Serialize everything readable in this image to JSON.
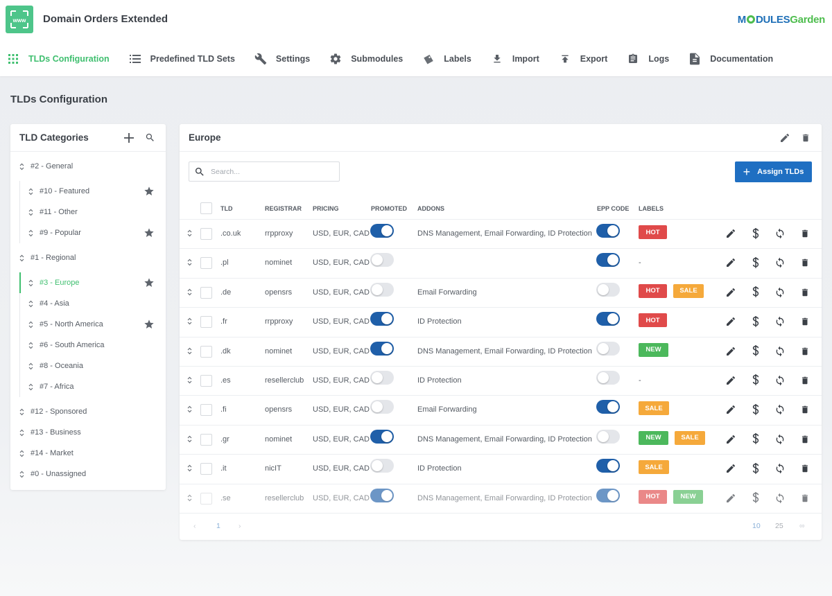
{
  "app": {
    "title": "Domain Orders Extended",
    "brand_part1": "M",
    "brand_part2": "DULES",
    "brand_part3": "Garden"
  },
  "nav": [
    {
      "label": "TLDs Configuration",
      "icon": "grid-icon",
      "active": true
    },
    {
      "label": "Predefined TLD Sets",
      "icon": "list-icon"
    },
    {
      "label": "Settings",
      "icon": "wrench-icon"
    },
    {
      "label": "Submodules",
      "icon": "gear-icon"
    },
    {
      "label": "Labels",
      "icon": "label-icon"
    },
    {
      "label": "Import",
      "icon": "download-icon"
    },
    {
      "label": "Export",
      "icon": "upload-icon"
    },
    {
      "label": "Logs",
      "icon": "clipboard-icon"
    },
    {
      "label": "Documentation",
      "icon": "document-icon"
    }
  ],
  "page_title": "TLDs Configuration",
  "categories_panel": {
    "title": "TLD Categories",
    "groups": [
      {
        "label": "#2 - General",
        "children": [
          {
            "label": "#10 - Featured",
            "starred": true
          },
          {
            "label": "#11 - Other",
            "starred": false
          },
          {
            "label": "#9 - Popular",
            "starred": true
          }
        ]
      },
      {
        "label": "#1 - Regional",
        "children": [
          {
            "label": "#3 - Europe",
            "starred": true,
            "active": true
          },
          {
            "label": "#4 - Asia",
            "starred": false
          },
          {
            "label": "#5 - North America",
            "starred": true
          },
          {
            "label": "#6 - South America",
            "starred": false
          },
          {
            "label": "#8 - Oceania",
            "starred": false
          },
          {
            "label": "#7 - Africa",
            "starred": false
          }
        ]
      },
      {
        "label": "#12 - Sponsored",
        "children": []
      },
      {
        "label": "#13 - Business",
        "children": []
      },
      {
        "label": "#14 - Market",
        "children": []
      },
      {
        "label": "#0 - Unassigned",
        "children": []
      }
    ]
  },
  "table_panel": {
    "title": "Europe",
    "search_placeholder": "Search...",
    "assign_label": "Assign TLDs",
    "columns": {
      "tld": "TLD",
      "registrar": "REGISTRAR",
      "pricing": "PRICING",
      "promoted": "PROMOTED",
      "addons": "ADDONS",
      "epp": "EPP CODE",
      "labels": "LABELS"
    },
    "rows": [
      {
        "tld": ".co.uk",
        "registrar": "rrpproxy",
        "pricing": "USD, EUR, CAD",
        "promoted": true,
        "addons": "DNS Management, Email Forwarding, ID Protection",
        "epp": true,
        "labels": [
          "HOT"
        ]
      },
      {
        "tld": ".pl",
        "registrar": "nominet",
        "pricing": "USD, EUR, CAD",
        "promoted": false,
        "addons": "",
        "epp": true,
        "labels": []
      },
      {
        "tld": ".de",
        "registrar": "opensrs",
        "pricing": "USD, EUR, CAD",
        "promoted": false,
        "addons": "Email Forwarding",
        "epp": false,
        "labels": [
          "HOT",
          "SALE"
        ]
      },
      {
        "tld": ".fr",
        "registrar": "rrpproxy",
        "pricing": "USD, EUR, CAD",
        "promoted": true,
        "addons": "ID Protection",
        "epp": true,
        "labels": [
          "HOT"
        ]
      },
      {
        "tld": ".dk",
        "registrar": "nominet",
        "pricing": "USD, EUR, CAD",
        "promoted": true,
        "addons": "DNS Management, Email Forwarding, ID Protection",
        "epp": false,
        "labels": [
          "NEW"
        ]
      },
      {
        "tld": ".es",
        "registrar": "resellerclub",
        "pricing": "USD, EUR, CAD",
        "promoted": false,
        "addons": "ID Protection",
        "epp": false,
        "labels": []
      },
      {
        "tld": ".fi",
        "registrar": "opensrs",
        "pricing": "USD, EUR, CAD",
        "promoted": false,
        "addons": "Email Forwarding",
        "epp": true,
        "labels": [
          "SALE"
        ]
      },
      {
        "tld": ".gr",
        "registrar": "nominet",
        "pricing": "USD, EUR, CAD",
        "promoted": true,
        "addons": "DNS Management, Email Forwarding, ID Protection",
        "epp": false,
        "labels": [
          "NEW",
          "SALE"
        ]
      },
      {
        "tld": ".it",
        "registrar": "nicIT",
        "pricing": "USD, EUR, CAD",
        "promoted": false,
        "addons": "ID Protection",
        "epp": true,
        "labels": [
          "SALE"
        ]
      },
      {
        "tld": ".se",
        "registrar": "resellerclub",
        "pricing": "USD, EUR, CAD",
        "promoted": true,
        "addons": "DNS Management, Email Forwarding, ID Protection",
        "epp": true,
        "labels": [
          "HOT",
          "NEW"
        ],
        "faded": true
      }
    ],
    "empty_label": "-",
    "pagination": {
      "current": "1",
      "sizes": [
        "10",
        "25",
        "∞"
      ]
    }
  },
  "colors": {
    "accent_green": "#3fbf6f",
    "primary_blue": "#1f6fc2",
    "toggle_on": "#1f5fa9",
    "hot": "#e04a4a",
    "sale": "#f5a93b",
    "new": "#4cb85c"
  }
}
